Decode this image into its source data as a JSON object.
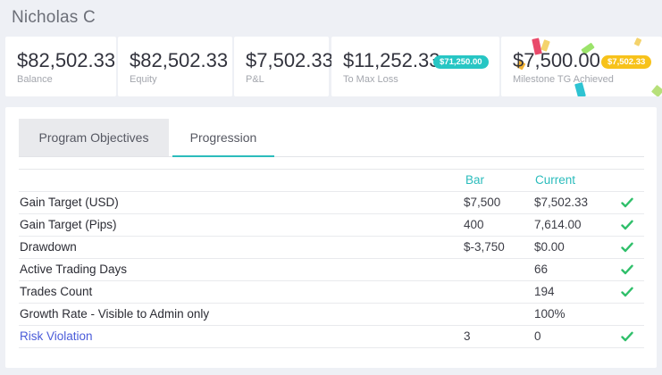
{
  "header": {
    "user_name": "Nicholas C"
  },
  "stats": {
    "balance": {
      "value": "$82,502.33",
      "label": "Balance"
    },
    "equity": {
      "value": "$82,502.33",
      "label": "Equity"
    },
    "pnl": {
      "value": "$7,502.33",
      "label": "P&L"
    },
    "max_loss": {
      "value": "$11,252.33",
      "label": "To Max Loss",
      "badge": "$71,250.00",
      "badge_color": "#27c6c4"
    },
    "milestone": {
      "value": "$7,500.00",
      "label": "Milestone TG Achieved",
      "badge": "$7,502.33",
      "badge_color": "#f7c21a"
    }
  },
  "tabs": [
    {
      "label": "Program Objectives",
      "active": false
    },
    {
      "label": "Progression",
      "active": true
    }
  ],
  "table": {
    "columns": {
      "label": "",
      "bar": "Bar",
      "current": "Current"
    },
    "rows": [
      {
        "label": "Gain Target (USD)",
        "bar": "$7,500",
        "current": "$7,502.33",
        "check": true
      },
      {
        "label": "Gain Target (Pips)",
        "bar": "400",
        "current": "7,614.00",
        "check": true
      },
      {
        "label": "Drawdown",
        "bar": "$-3,750",
        "current": "$0.00",
        "check": true
      },
      {
        "label": "Active Trading Days",
        "bar": "",
        "current": "66",
        "check": true
      },
      {
        "label": "Trades Count",
        "bar": "",
        "current": "194",
        "check": true
      },
      {
        "label": "Growth Rate - Visible to Admin only",
        "bar": "",
        "current": "100%",
        "check": false
      },
      {
        "label": "Risk Violation",
        "bar": "3",
        "current": "0",
        "check": true,
        "is_link": true
      }
    ]
  },
  "colors": {
    "accent": "#2bbcbc",
    "check": "#2fbf6a",
    "link": "#4a5bd9"
  },
  "icons": {
    "check": "checkmark-icon"
  }
}
